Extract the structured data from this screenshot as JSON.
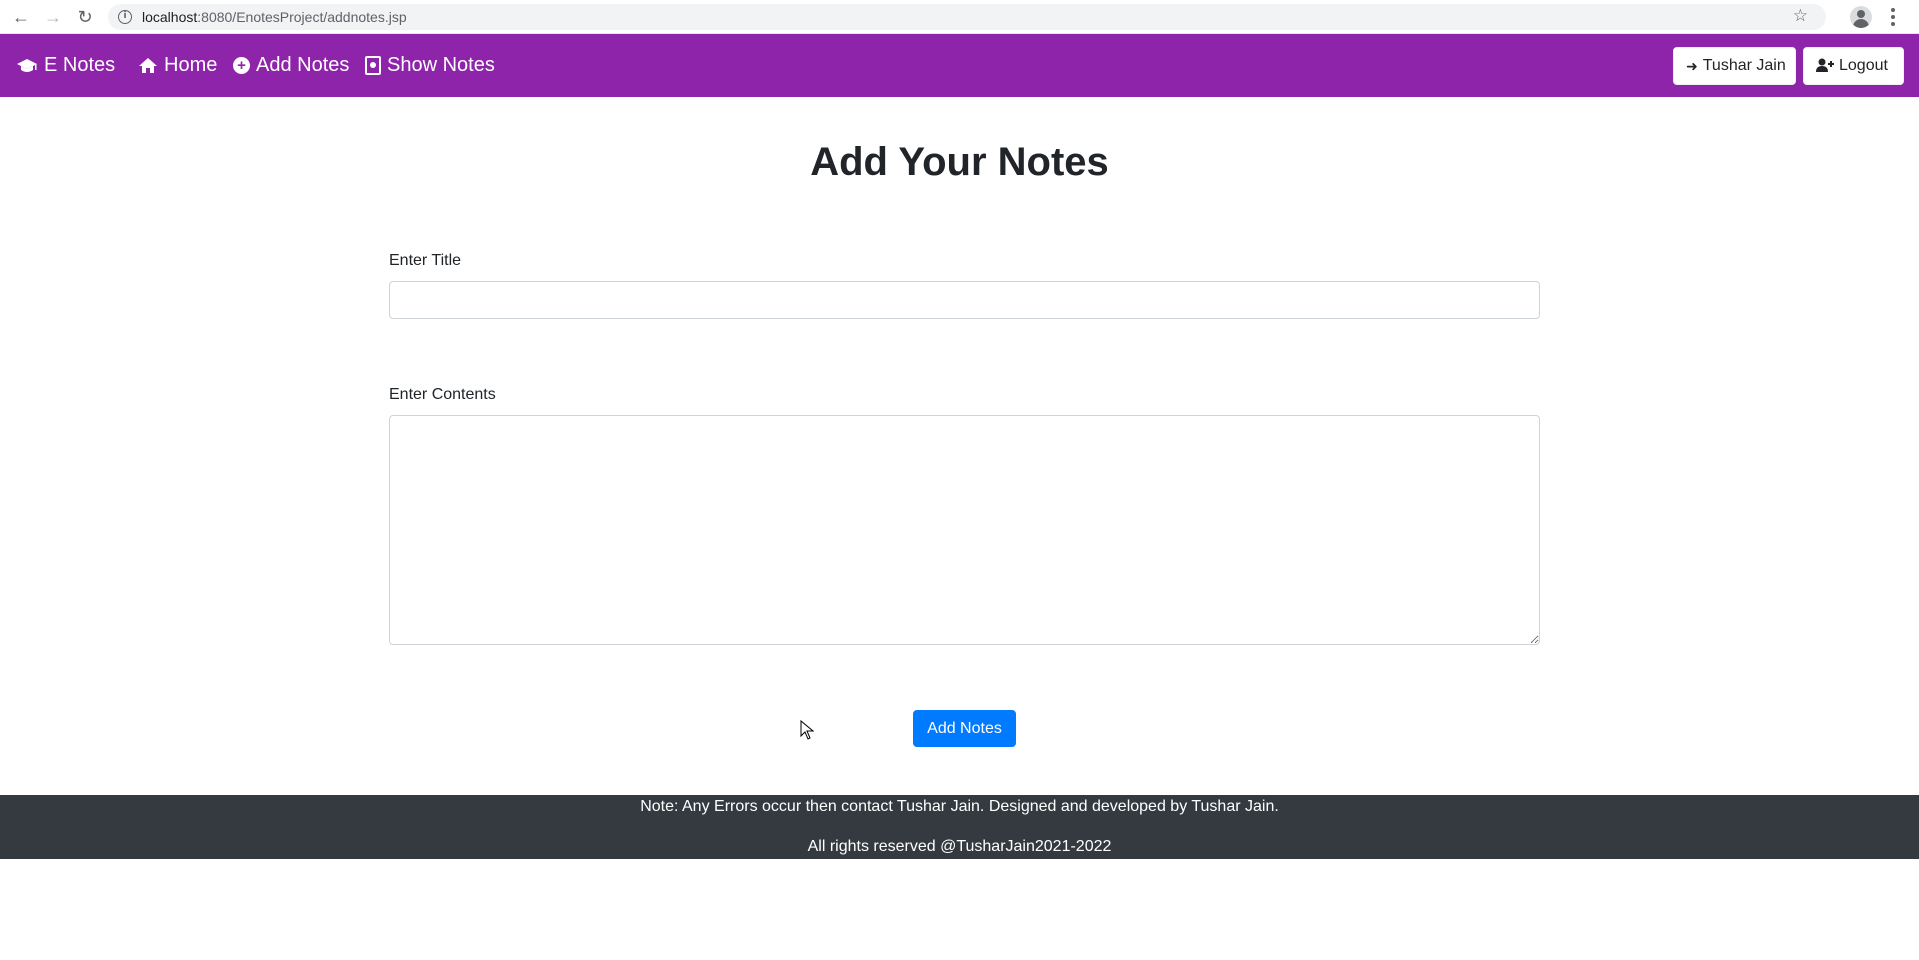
{
  "browser": {
    "url_host": "localhost",
    "url_rest": ":8080/EnotesProject/addnotes.jsp"
  },
  "navbar": {
    "brand": "E Notes",
    "items": [
      {
        "label": "Home",
        "icon": "home-icon"
      },
      {
        "label": "Add Notes",
        "icon": "plus-circle-icon"
      },
      {
        "label": "Show Notes",
        "icon": "address-book-icon"
      }
    ],
    "user_button": "Tushar Jain",
    "logout_button": "Logout"
  },
  "main": {
    "title": "Add Your Notes",
    "title_field": {
      "label": "Enter Title",
      "value": ""
    },
    "contents_field": {
      "label": "Enter Contents",
      "value": ""
    },
    "submit_label": "Add Notes"
  },
  "footer": {
    "line1": "Note: Any Errors occur then contact Tushar Jain. Designed and developed by Tushar Jain.",
    "line2": "All rights reserved @TusharJain2021-2022"
  },
  "colors": {
    "navbar": "#8e24aa",
    "primary_button": "#007bff",
    "footer": "#343a40"
  }
}
